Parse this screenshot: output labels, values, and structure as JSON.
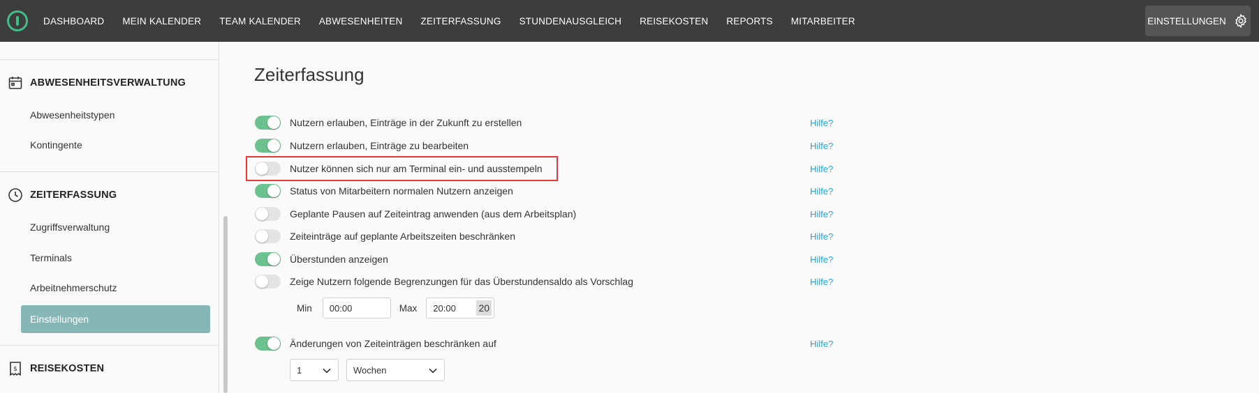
{
  "nav": {
    "items": [
      "DASHBOARD",
      "MEIN KALENDER",
      "TEAM KALENDER",
      "ABWESENHEITEN",
      "ZEITERFASSUNG",
      "STUNDENAUSGLEICH",
      "REISEKOSTEN",
      "REPORTS",
      "MITARBEITER"
    ],
    "settings_label": "EINSTELLUNGEN"
  },
  "sidebar": {
    "sections": [
      {
        "label": "ABWESENHEITSVERWALTUNG",
        "icon": "calendar-icon",
        "items": [
          "Abwesenheitstypen",
          "Kontingente"
        ]
      },
      {
        "label": "ZEITERFASSUNG",
        "icon": "clock-icon",
        "items": [
          "Zugriffsverwaltung",
          "Terminals",
          "Arbeitnehmerschutz",
          "Einstellungen"
        ]
      },
      {
        "label": "REISEKOSTEN",
        "icon": "receipt-icon",
        "items": []
      }
    ],
    "active_item": "Einstellungen"
  },
  "main": {
    "title": "Zeiterfassung",
    "help_label": "Hilfe?",
    "settings": [
      {
        "label": "Nutzern erlauben, Einträge in der Zukunft zu erstellen",
        "on": true
      },
      {
        "label": "Nutzern erlauben, Einträge zu bearbeiten",
        "on": true
      },
      {
        "label": "Nutzer können sich nur am Terminal ein- und ausstempeln",
        "on": false
      },
      {
        "label": "Status von Mitarbeitern normalen Nutzern anzeigen",
        "on": true
      },
      {
        "label": "Geplante Pausen auf Zeiteintrag anwenden (aus dem Arbeitsplan)",
        "on": false
      },
      {
        "label": "Zeiteinträge auf geplante Arbeitszeiten beschränken",
        "on": false
      },
      {
        "label": "Überstunden anzeigen",
        "on": true
      },
      {
        "label": "Zeige Nutzern folgende Begrenzungen für das Überstundensaldo als Vorschlag",
        "on": false
      }
    ],
    "min_label": "Min",
    "min_value": "00:00",
    "max_label": "Max",
    "max_value": "20:00",
    "max_spin": "20",
    "restrict": {
      "label": "Änderungen von Zeiteinträgen beschränken auf",
      "on": true
    },
    "restrict_count": "1",
    "restrict_unit": "Wochen"
  },
  "colors": {
    "accent": "#6cc28e",
    "active_sidebar": "#86b7b6",
    "link": "#1fa6d8",
    "highlight": "#e53935",
    "topbar": "#3d3d3d"
  }
}
